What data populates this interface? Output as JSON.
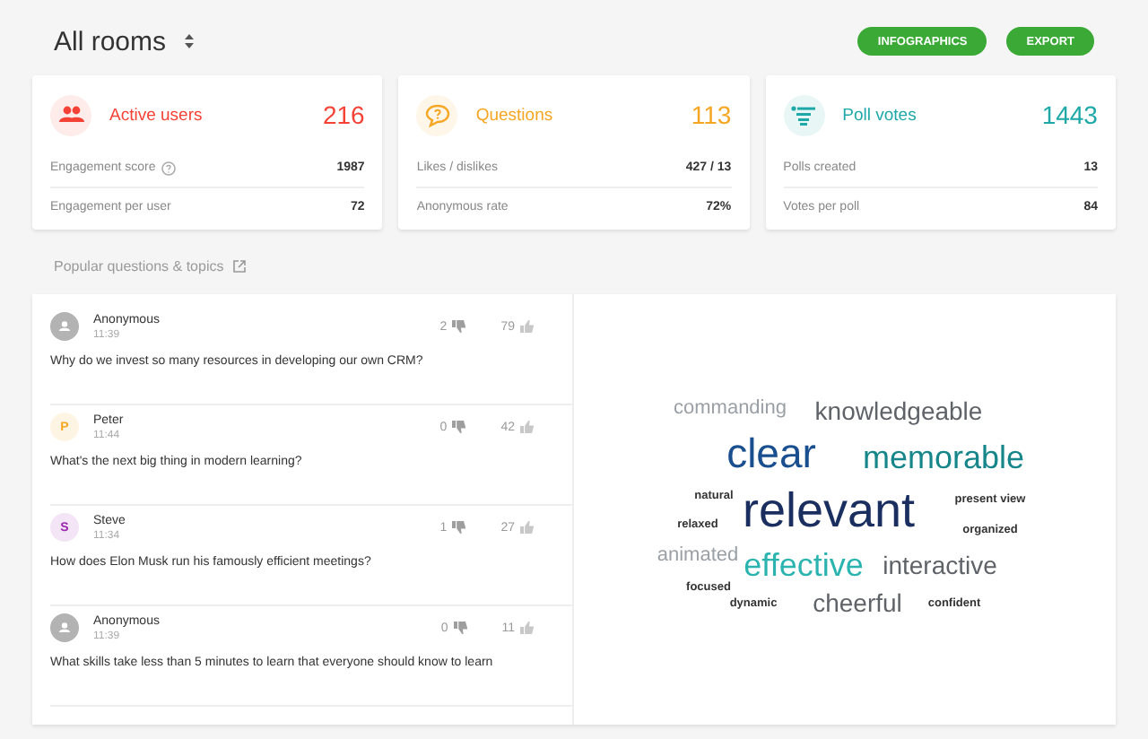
{
  "header": {
    "title": "All rooms",
    "buttons": [
      "INFOGRAPHICS",
      "EXPORT"
    ]
  },
  "cards": [
    {
      "kind": "users",
      "title": "Active users",
      "value": "216",
      "color": "#f44336",
      "stats": [
        {
          "label": "Engagement score",
          "info": true,
          "value": "1987"
        },
        {
          "label": "Engagement per user",
          "info": false,
          "value": "72"
        }
      ]
    },
    {
      "kind": "questions",
      "title": "Questions",
      "value": "113",
      "color": "#f5a623",
      "stats": [
        {
          "label": "Likes / dislikes",
          "info": false,
          "value": "427 / 13"
        },
        {
          "label": "Anonymous rate",
          "info": false,
          "value": "72%"
        }
      ]
    },
    {
      "kind": "polls",
      "title": "Poll votes",
      "value": "1443",
      "color": "#1fa8a8",
      "stats": [
        {
          "label": "Polls created",
          "info": false,
          "value": "13"
        },
        {
          "label": "Votes per poll",
          "info": false,
          "value": "84"
        }
      ]
    }
  ],
  "section_title": "Popular questions & topics",
  "questions": [
    {
      "author": "Anonymous",
      "avatar": {
        "kind": "anonymous",
        "color": "#b3b3b3"
      },
      "time": "11:39",
      "dislikes": "2",
      "likes": "79",
      "text": "Why do we invest so many resources in developing our own CRM?"
    },
    {
      "author": "Peter",
      "avatar": {
        "kind": "initial",
        "letter": "P",
        "color": "#f5a623"
      },
      "time": "11:44",
      "dislikes": "0",
      "likes": "42",
      "text": "What's the next big thing in modern learning?"
    },
    {
      "author": "Steve",
      "avatar": {
        "kind": "initial",
        "letter": "S",
        "color": "#9c27b0"
      },
      "time": "11:34",
      "dislikes": "1",
      "likes": "27",
      "text": "How does Elon Musk run his famously efficient meetings?"
    },
    {
      "author": "Anonymous",
      "avatar": {
        "kind": "anonymous",
        "color": "#b3b3b3"
      },
      "time": "11:39",
      "dislikes": "0",
      "likes": "11",
      "text": "What skills take less than 5 minutes to learn that everyone should know to learn"
    }
  ],
  "word_cloud": [
    {
      "word": "commanding",
      "kind": "small",
      "color": "#9aa0a6"
    },
    {
      "word": "knowledgeable",
      "kind": "medium",
      "color": "#5f6368"
    },
    {
      "word": "clear",
      "kind": "huge",
      "color": "#1a4f8f"
    },
    {
      "word": "memorable",
      "kind": "large",
      "color": "#16868a"
    },
    {
      "word": "natural",
      "kind": "tiny",
      "color": "#333333"
    },
    {
      "word": "relevant",
      "kind": "giant",
      "color": "#1a2f5f"
    },
    {
      "word": "present view",
      "kind": "tiny",
      "color": "#333333"
    },
    {
      "word": "relaxed",
      "kind": "tiny",
      "color": "#333333"
    },
    {
      "word": "organized",
      "kind": "tiny",
      "color": "#333333"
    },
    {
      "word": "animated",
      "kind": "small",
      "color": "#9aa0a6"
    },
    {
      "word": "effective",
      "kind": "large",
      "color": "#2bb3b0"
    },
    {
      "word": "interactive",
      "kind": "medium",
      "color": "#5f6368"
    },
    {
      "word": "focused",
      "kind": "tiny",
      "color": "#333333"
    },
    {
      "word": "dynamic",
      "kind": "tiny",
      "color": "#333333"
    },
    {
      "word": "cheerful",
      "kind": "medium",
      "color": "#5f6368"
    },
    {
      "word": "confident",
      "kind": "tiny",
      "color": "#333333"
    }
  ]
}
